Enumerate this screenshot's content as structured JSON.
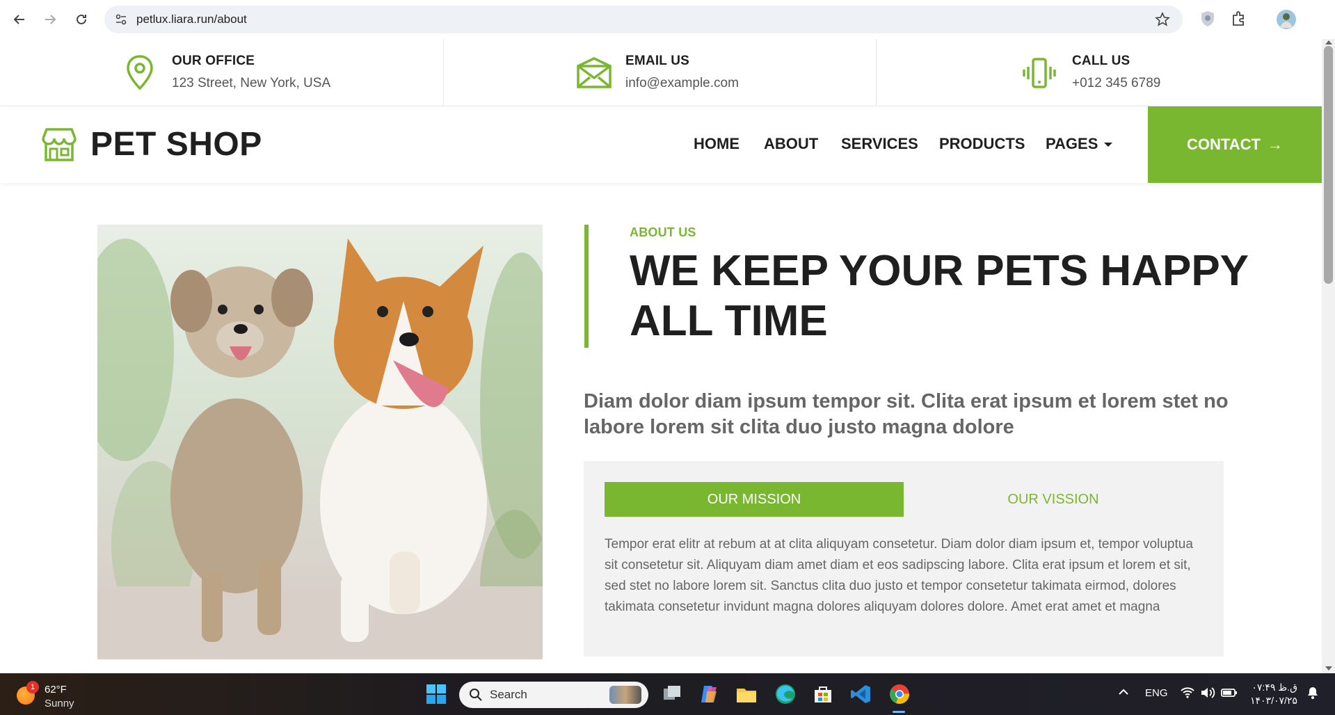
{
  "browser": {
    "url": "petlux.liara.run/about"
  },
  "topbar": {
    "office": {
      "title": "OUR OFFICE",
      "value": "123 Street, New York, USA"
    },
    "email": {
      "title": "EMAIL US",
      "value": "info@example.com"
    },
    "call": {
      "title": "CALL US",
      "value": "+012 345 6789"
    }
  },
  "navbar": {
    "brand": "PET SHOP",
    "menu": [
      "HOME",
      "ABOUT",
      "SERVICES",
      "PRODUCTS",
      "PAGES"
    ],
    "contact": "CONTACT",
    "contact_arrow": "→"
  },
  "about": {
    "eyebrow": "ABOUT US",
    "title": "WE KEEP YOUR PETS HAPPY ALL TIME",
    "lead": "Diam dolor diam ipsum tempor sit. Clita erat ipsum et lorem stet no labore lorem sit clita duo justo magna dolore",
    "tabs": [
      "OUR MISSION",
      "OUR VISSION"
    ],
    "tab_text": "Tempor erat elitr at rebum at at clita aliquyam consetetur. Diam dolor diam ipsum et, tempor voluptua sit consetetur sit. Aliquyam diam amet diam et eos sadipscing labore. Clita erat ipsum et lorem et sit, sed stet no labore lorem sit. Sanctus clita duo justo et tempor consetetur takimata eirmod, dolores takimata consetetur invidunt magna dolores aliquyam dolores dolore. Amet erat amet et magna"
  },
  "taskbar": {
    "weather_badge": "1",
    "temperature": "62°F",
    "condition": "Sunny",
    "search": "Search",
    "language": "ENG",
    "time": "۰۷:۴۹ ق.ظ",
    "date": "۱۴۰۳/۰۷/۲۵"
  },
  "colors": {
    "accent": "#7ab730",
    "dark": "#1f1f1f"
  }
}
